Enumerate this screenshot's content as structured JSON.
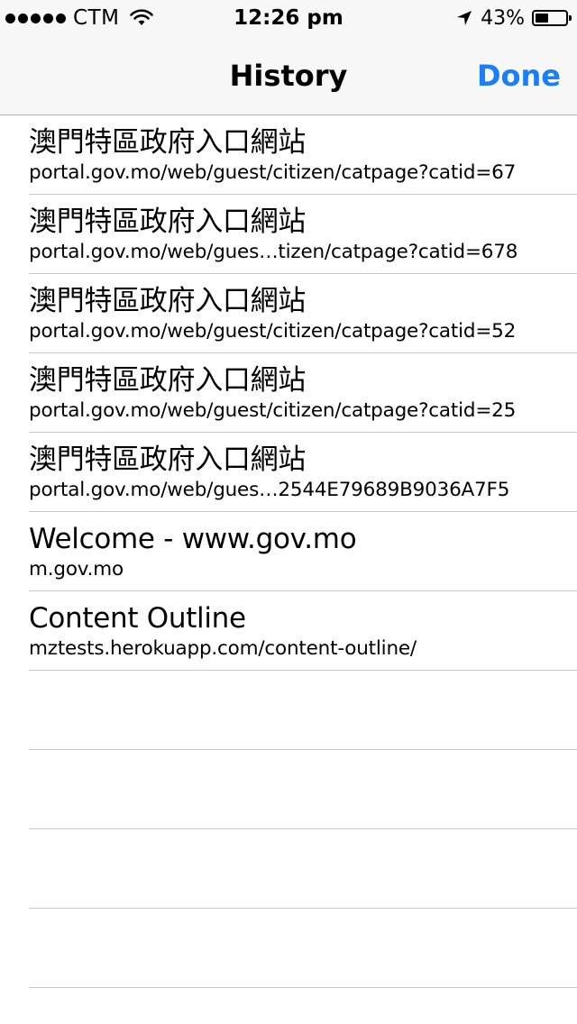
{
  "status_bar": {
    "carrier": "CTM",
    "time": "12:26 pm",
    "battery_percent": "43%",
    "battery_level": 0.43,
    "icons": [
      "signal-dots",
      "wifi-icon",
      "location-arrow-icon",
      "battery-icon"
    ]
  },
  "nav": {
    "title": "History",
    "done_label": "Done",
    "accent_color": "#1a7ef6"
  },
  "history": [
    {
      "title": "澳門特區政府入口網站",
      "url": "portal.gov.mo/web/guest/citizen/catpage?catid=67"
    },
    {
      "title": "澳門特區政府入口網站",
      "url": "portal.gov.mo/web/gues…tizen/catpage?catid=678"
    },
    {
      "title": "澳門特區政府入口網站",
      "url": "portal.gov.mo/web/guest/citizen/catpage?catid=52"
    },
    {
      "title": "澳門特區政府入口網站",
      "url": "portal.gov.mo/web/guest/citizen/catpage?catid=25"
    },
    {
      "title": "澳門特區政府入口網站",
      "url": "portal.gov.mo/web/gues…2544E79689B9036A7F5"
    },
    {
      "title": "Welcome - www.gov.mo",
      "url": "m.gov.mo"
    },
    {
      "title": "Content Outline",
      "url": "mztests.herokuapp.com/content-outline/"
    },
    {
      "title": "",
      "url": ""
    },
    {
      "title": "",
      "url": ""
    },
    {
      "title": "",
      "url": ""
    },
    {
      "title": "",
      "url": ""
    }
  ]
}
